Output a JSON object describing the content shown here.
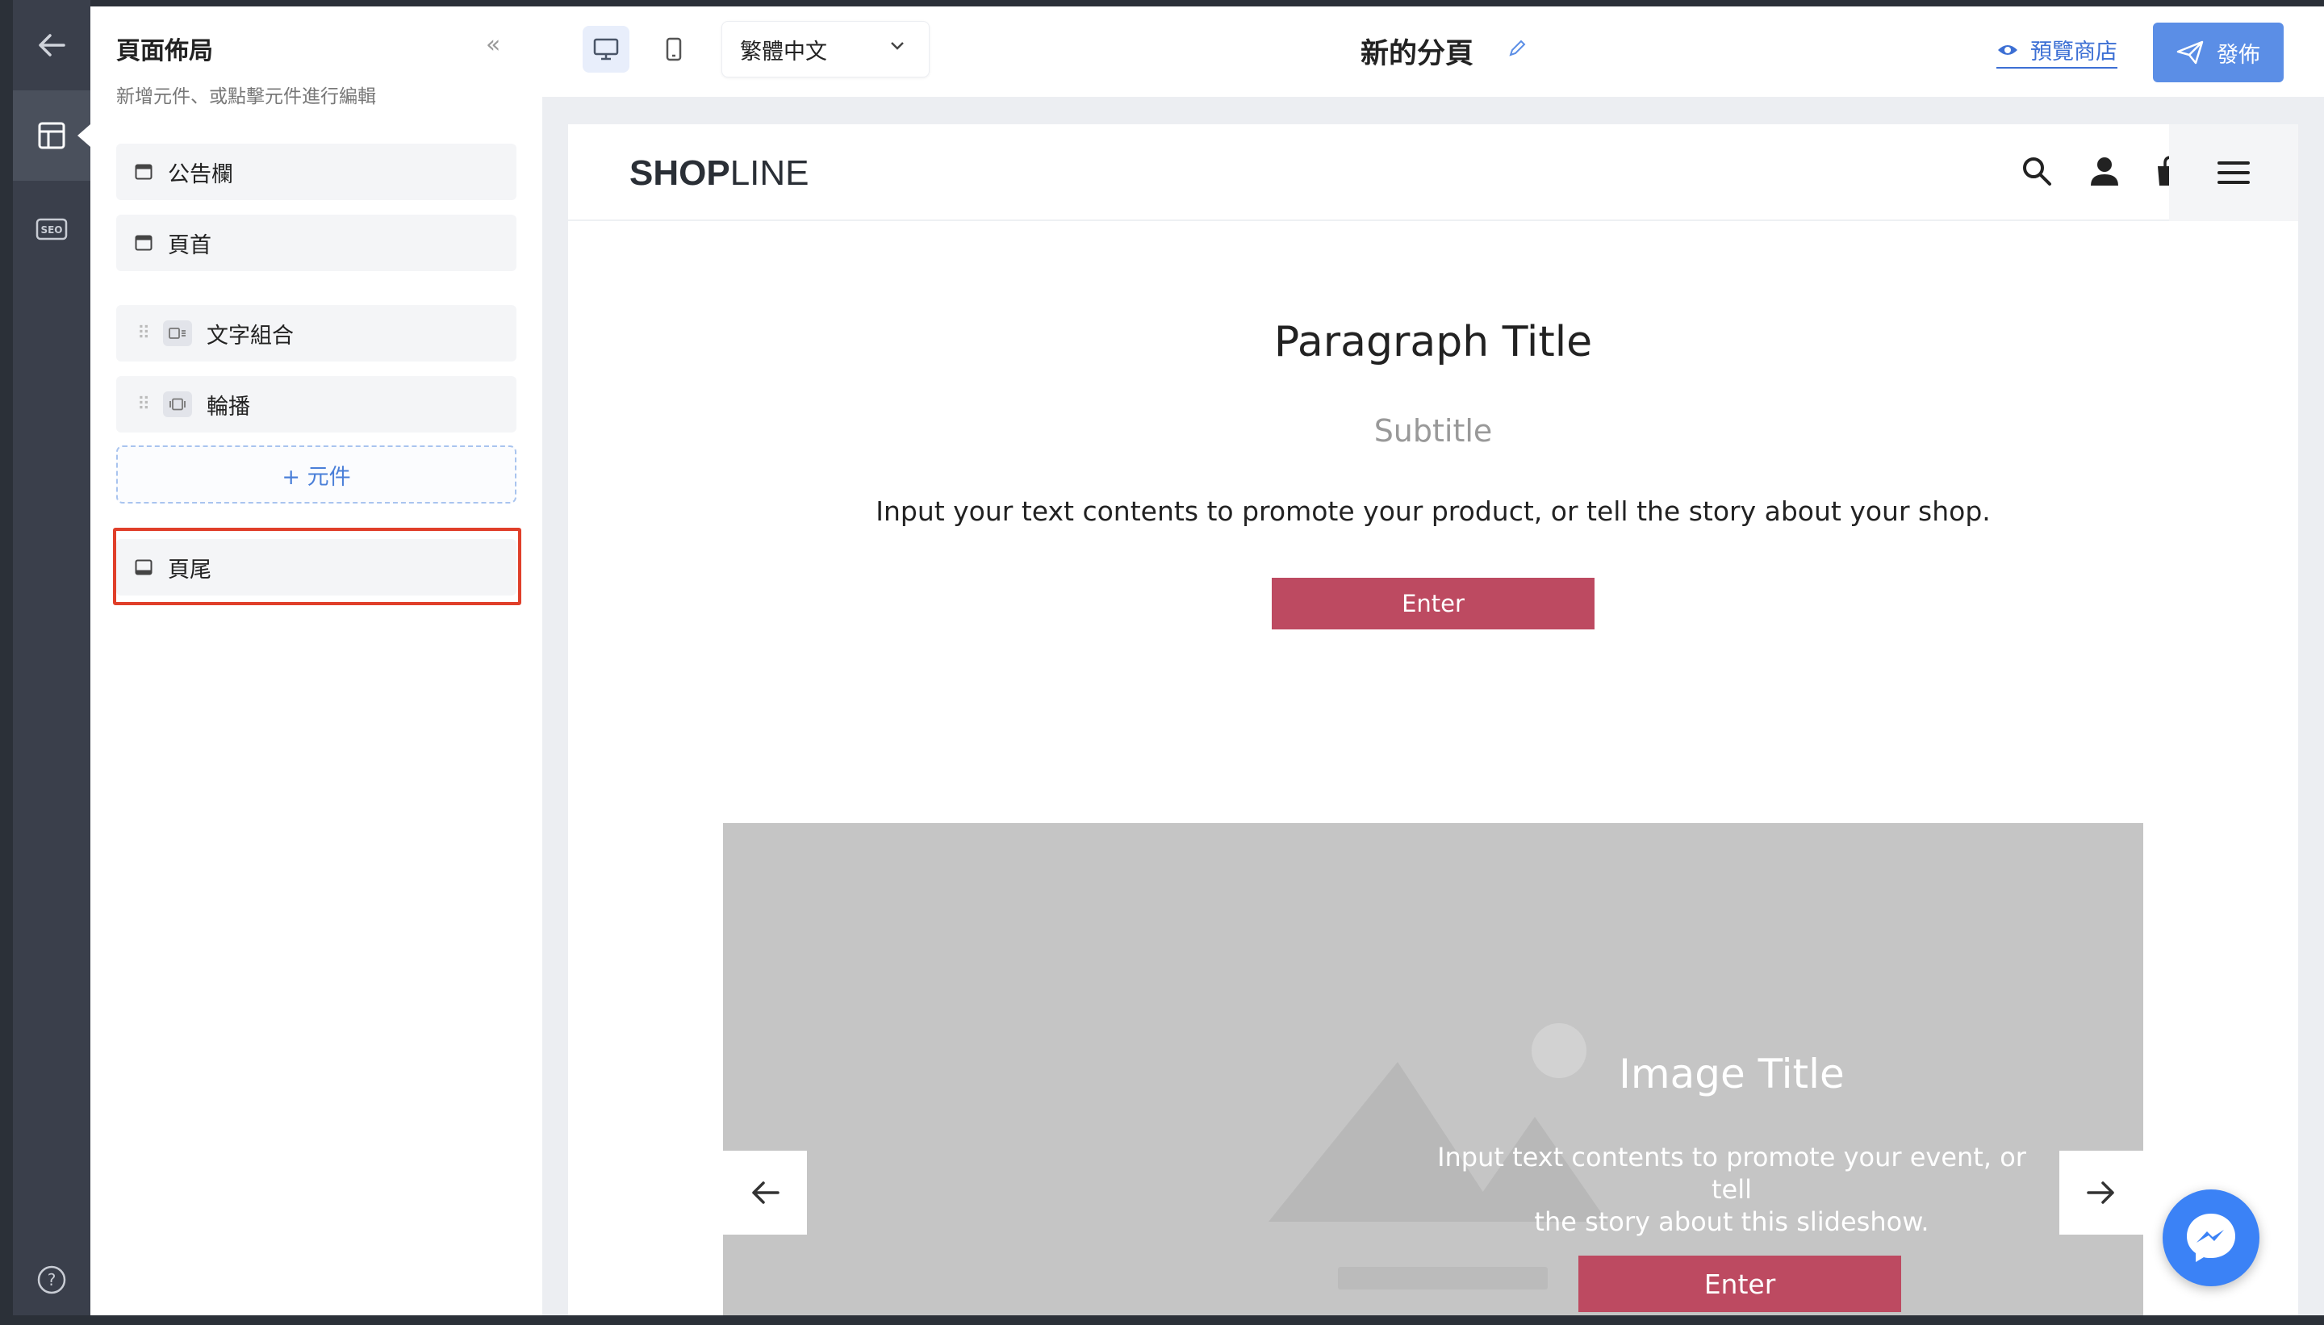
{
  "rail": {
    "icons": [
      "back-arrow-icon",
      "layout-icon",
      "seo-icon",
      "help-icon"
    ],
    "seo_label": "SEO"
  },
  "panel": {
    "title": "頁面佈局",
    "subtitle": "新增元件、或點擊元件進行編輯",
    "collapse_glyph": "«",
    "fixed_sections": [
      {
        "label": "公告欄",
        "icon": "window-top-icon"
      },
      {
        "label": "頁首",
        "icon": "window-top-icon"
      }
    ],
    "components": [
      {
        "label": "文字組合",
        "icon": "text-block-icon"
      },
      {
        "label": "輪播",
        "icon": "carousel-icon"
      }
    ],
    "add_button": "+ 元件",
    "footer_section": {
      "label": "頁尾",
      "icon": "window-bottom-icon"
    },
    "highlight_color": "#e03f2a"
  },
  "toolbar": {
    "language": "繁體中文",
    "page_name": "新的分頁",
    "preview_label": "預覽商店",
    "publish_label": "發佈",
    "accent_color": "#5b8ee6"
  },
  "site": {
    "logo_bold": "SHOP",
    "logo_thin": "LINE",
    "header_icons": [
      "search-icon",
      "user-icon",
      "shopping-bag-icon",
      "hamburger-icon"
    ],
    "text_block": {
      "title": "Paragraph Title",
      "subtitle": "Subtitle",
      "body": "Input your text contents to promote your product, or tell the story about your shop.",
      "button": "Enter"
    },
    "slideshow": {
      "title": "Image Title",
      "body_line1": "Input text contents to promote your event, or tell",
      "body_line2": "the story about this slideshow.",
      "button": "Enter"
    },
    "button_color": "#bd4a61"
  },
  "messenger": {
    "icon": "messenger-icon",
    "color": "#3b82f6"
  }
}
